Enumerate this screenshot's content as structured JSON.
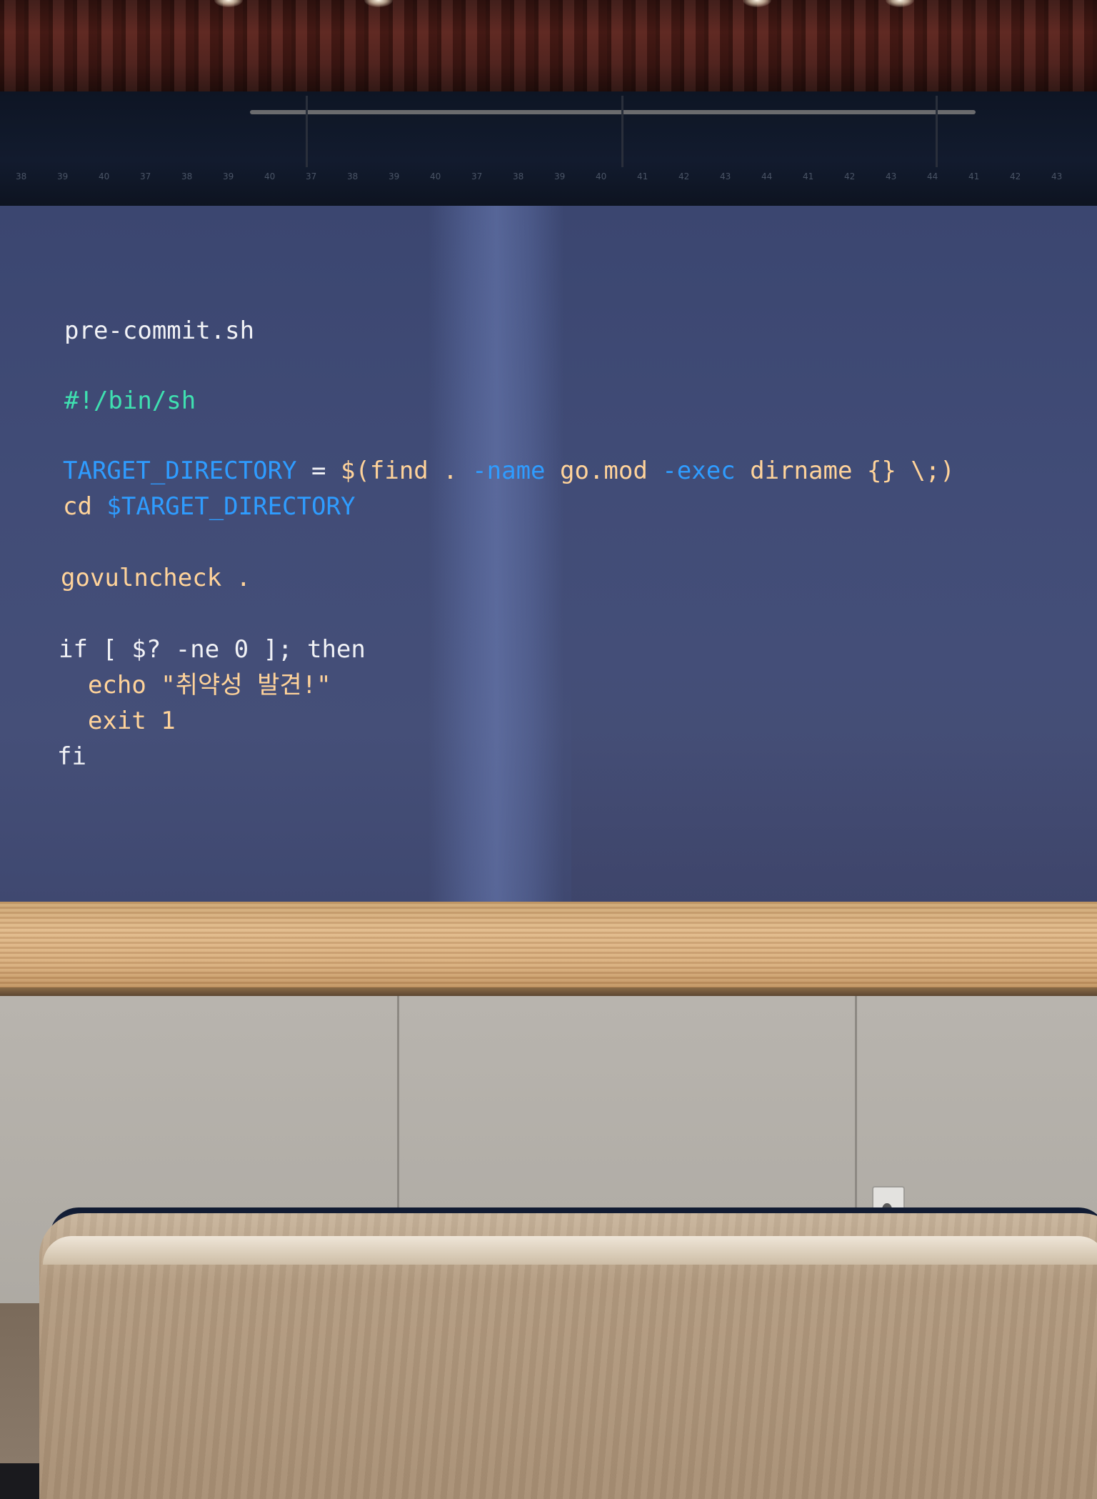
{
  "scene": "auditorium-stage-projection",
  "slide": {
    "filename": "pre-commit.sh",
    "lines": [
      {
        "tokens": [
          {
            "text": "#!/bin/sh",
            "color": "green"
          }
        ]
      },
      {
        "tokens": [
          {
            "text": "TARGET_DIRECTORY",
            "color": "blue"
          },
          {
            "text": " = ",
            "color": "white"
          },
          {
            "text": "$(find . ",
            "color": "orange"
          },
          {
            "text": "-name",
            "color": "blue"
          },
          {
            "text": " go.mod ",
            "color": "orange"
          },
          {
            "text": "-exec",
            "color": "blue"
          },
          {
            "text": " dirname {} \\;)",
            "color": "orange"
          }
        ]
      },
      {
        "tokens": [
          {
            "text": "cd ",
            "color": "orange"
          },
          {
            "text": "$TARGET_DIRECTORY",
            "color": "blue"
          }
        ]
      },
      {
        "tokens": [
          {
            "text": "govulncheck .",
            "color": "orange"
          }
        ]
      },
      {
        "tokens": [
          {
            "text": "if [ $? -ne 0 ]; then",
            "color": "white"
          }
        ]
      },
      {
        "tokens": [
          {
            "text": "  echo \"취약성 발견!\"",
            "color": "orange"
          }
        ]
      },
      {
        "tokens": [
          {
            "text": "  exit 1",
            "color": "orange"
          }
        ]
      },
      {
        "tokens": [
          {
            "text": "fi",
            "color": "white"
          }
        ]
      }
    ]
  },
  "palette": {
    "screen": "#414c77",
    "code_white": "#f1f2f6",
    "code_green": "#3fe0b0",
    "code_blue": "#2f9cff",
    "code_orange": "#ffd39a"
  },
  "seat_numbers": [
    "38",
    "39",
    "40",
    "37",
    "38",
    "39",
    "40",
    "37",
    "38",
    "39",
    "40",
    "37",
    "38",
    "39",
    "40",
    "41",
    "42",
    "43",
    "44",
    "41",
    "42",
    "43",
    "44",
    "41",
    "42",
    "43"
  ]
}
